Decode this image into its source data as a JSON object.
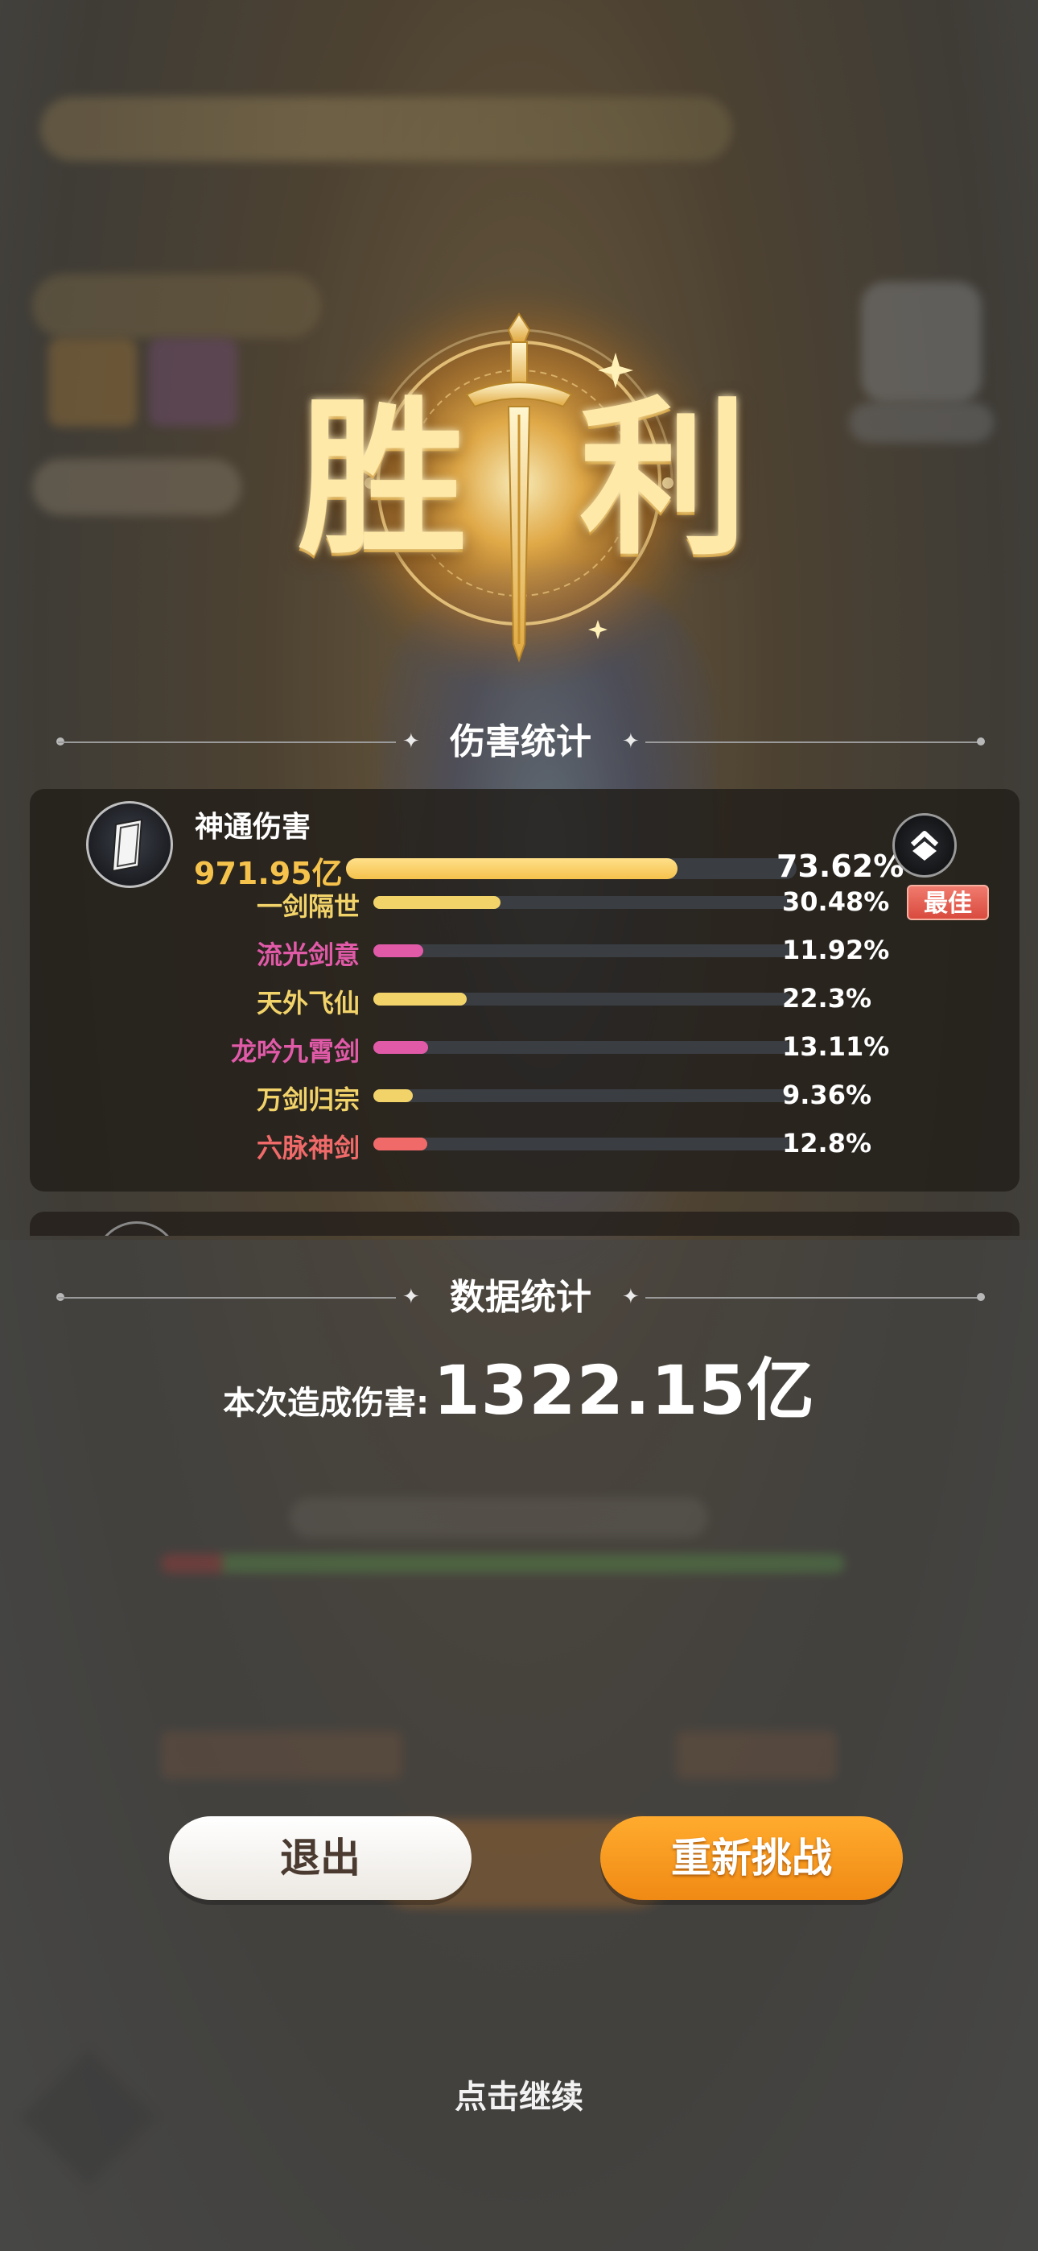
{
  "victory": {
    "title_chars": [
      "胜",
      "利"
    ]
  },
  "damage_stats": {
    "header": "伤害统计",
    "main": {
      "icon": "book-icon",
      "name": "神通伤害",
      "value": "971.95亿",
      "percent_text": "73.62%",
      "percent": 73.62
    },
    "collapse_icon": "chevron-up-icon",
    "skills": [
      {
        "name": "一剑隔世",
        "percent_text": "30.48%",
        "percent": 30.48,
        "color": "#f2d36a",
        "best": "最佳"
      },
      {
        "name": "流光剑意",
        "percent_text": "11.92%",
        "percent": 11.92,
        "color": "#e05aa8"
      },
      {
        "name": "天外飞仙",
        "percent_text": "22.3%",
        "percent": 22.3,
        "color": "#f2d36a"
      },
      {
        "name": "龙吟九霄剑",
        "percent_text": "13.11%",
        "percent": 13.11,
        "color": "#e05aa8"
      },
      {
        "name": "万剑归宗",
        "percent_text": "9.36%",
        "percent": 9.36,
        "color": "#f2d36a"
      },
      {
        "name": "六脉神剑",
        "percent_text": "12.8%",
        "percent": 12.8,
        "color": "#f06a6a"
      }
    ]
  },
  "data_stats": {
    "header": "数据统计",
    "total_label": "本次造成伤害:",
    "total_value": "1322.15亿"
  },
  "buttons": {
    "exit": "退出",
    "retry": "重新挑战"
  },
  "footer": {
    "continue": "点击继续"
  },
  "colors": {
    "gold": "#f5c24c",
    "retry_orange": "#f08a14"
  }
}
